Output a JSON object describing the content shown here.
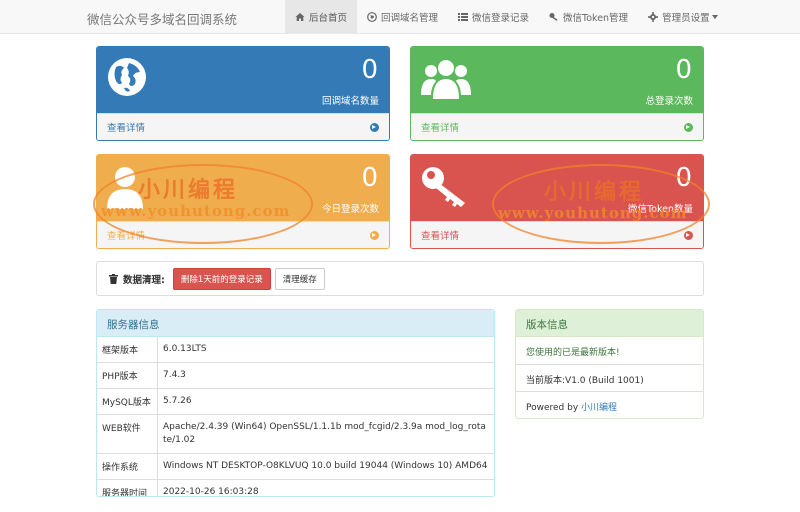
{
  "brand": "微信公众号多域名回调系统",
  "nav": [
    {
      "label": "后台首页",
      "icon": "home-icon"
    },
    {
      "label": "回调域名管理",
      "icon": "globe-icon"
    },
    {
      "label": "微信登录记录",
      "icon": "list-icon"
    },
    {
      "label": "微信Token管理",
      "icon": "key-icon"
    },
    {
      "label": "管理员设置",
      "icon": "gear-icon"
    }
  ],
  "stats": [
    {
      "value": "0",
      "label": "回调域名数量",
      "link": "查看详情",
      "icon": "globe-icon",
      "color": "#337ab7"
    },
    {
      "value": "0",
      "label": "总登录次数",
      "link": "查看详情",
      "icon": "users-icon",
      "color": "#5cb85c"
    },
    {
      "value": "0",
      "label": "今日登录次数",
      "link": "查看详情",
      "icon": "user-icon",
      "color": "#f0ad4e"
    },
    {
      "value": "0",
      "label": "微信Token数量",
      "link": "查看详情",
      "icon": "key-icon",
      "color": "#d9534f"
    }
  ],
  "cleanup": {
    "title": "数据清理:",
    "delete_label": "删除1天前的登录记录",
    "cache_label": "清理缓存"
  },
  "server": {
    "title": "服务器信息",
    "rows": [
      {
        "k": "框架版本",
        "v": "6.0.13LTS"
      },
      {
        "k": "PHP版本",
        "v": "7.4.3"
      },
      {
        "k": "MySQL版本",
        "v": "5.7.26"
      },
      {
        "k": "WEB软件",
        "v": "Apache/2.4.39 (Win64) OpenSSL/1.1.1b mod_fcgid/2.3.9a mod_log_rotate/1.02"
      },
      {
        "k": "操作系统",
        "v": "Windows NT DESKTOP-O8KLVUQ 10.0 build 19044 (Windows 10) AMD64"
      },
      {
        "k": "服务器时间",
        "v": "2022-10-26 16:03:28"
      }
    ]
  },
  "version": {
    "title": "版本信息",
    "latest": "您使用的已是最新版本!",
    "current": "当前版本:V1.0 (Build 1001)",
    "powered_prefix": "Powered by",
    "powered_link": "小川编程"
  },
  "watermark": {
    "cn": "小川编程",
    "en": "www.youhutong.com"
  }
}
